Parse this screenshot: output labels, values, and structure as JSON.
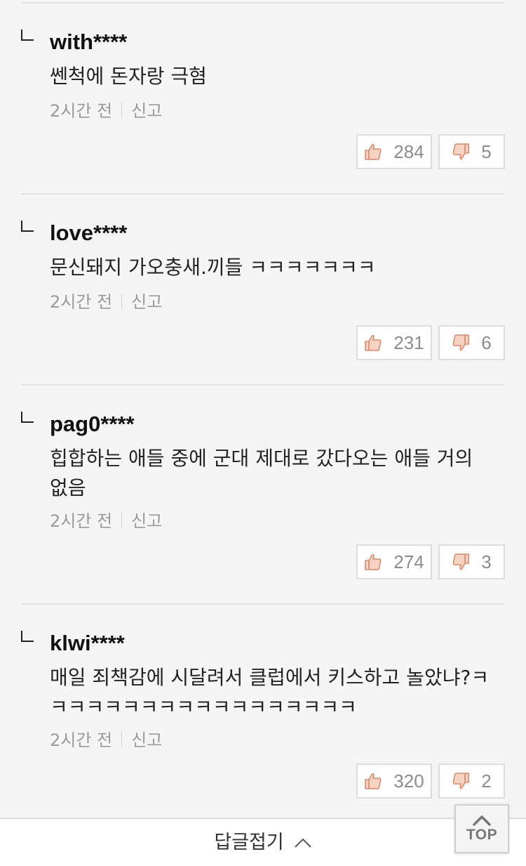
{
  "comments": [
    {
      "username": "with****",
      "text": "쎈척에 돈자랑 극혐",
      "time": "2시간 전",
      "report": "신고",
      "likes": "284",
      "dislikes": "5"
    },
    {
      "username": "love****",
      "text": "문신돼지 가오충새.끼들 ㅋㅋㅋㅋㅋㅋㅋ",
      "time": "2시간 전",
      "report": "신고",
      "likes": "231",
      "dislikes": "6"
    },
    {
      "username": "pag0****",
      "text": "힙합하는 애들 중에 군대 제대로 갔다오는 애들 거의 없음",
      "time": "2시간 전",
      "report": "신고",
      "likes": "274",
      "dislikes": "3"
    },
    {
      "username": "klwi****",
      "text": "매일 죄책감에 시달려서 클럽에서 키스하고 놀았냐?ㅋㅋㅋㅋㅋㅋㅋㅋㅋㅋㅋㅋㅋㅋㅋㅋㅋㅋ",
      "time": "2시간 전",
      "report": "신고",
      "likes": "320",
      "dislikes": "2"
    }
  ],
  "footer": {
    "collapse_label": "답글접기",
    "top_label": "TOP"
  },
  "icons": {
    "like": "thumbs-up-icon",
    "dislike": "thumbs-down-icon",
    "collapse": "chevron-up-icon",
    "top": "arrow-up-icon"
  },
  "colors": {
    "background": "#f5f5f5",
    "thumb_fill": "#f7d3c4",
    "thumb_stroke": "#d98a6a",
    "muted_text": "#9a9a9a"
  }
}
